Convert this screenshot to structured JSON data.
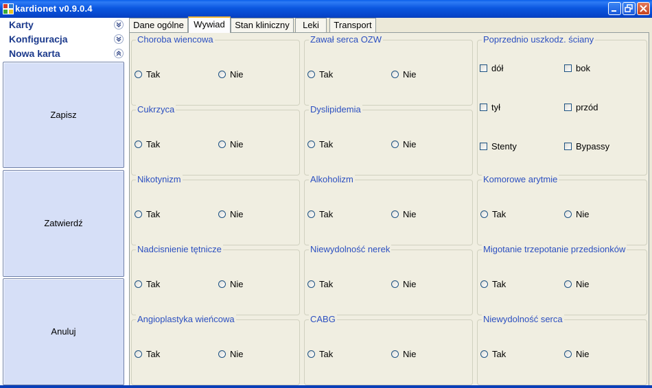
{
  "window": {
    "title": "kardionet v0.9.0.4"
  },
  "sidebar": {
    "nav": [
      {
        "label": "Karty",
        "expanded": false
      },
      {
        "label": "Konfiguracja",
        "expanded": false
      },
      {
        "label": "Nowa karta",
        "expanded": true
      }
    ],
    "buttons": {
      "save": "Zapisz",
      "confirm": "Zatwierdź",
      "cancel": "Anuluj"
    }
  },
  "tabs": [
    {
      "label": "Dane ogólne",
      "active": false
    },
    {
      "label": "Wywiad",
      "active": true
    },
    {
      "label": "Stan kliniczny",
      "active": false
    },
    {
      "label": "Leki",
      "active": false
    },
    {
      "label": "Transport",
      "active": false
    }
  ],
  "radio_groups": [
    {
      "title": "Choroba wiencowa",
      "yes": "Tak",
      "no": "Nie"
    },
    {
      "title": "Zawał serca OZW",
      "yes": "Tak",
      "no": "Nie"
    },
    {
      "title": "Cukrzyca",
      "yes": "Tak",
      "no": "Nie"
    },
    {
      "title": "Dyslipidemia",
      "yes": "Tak",
      "no": "Nie"
    },
    {
      "title": "Nikotynizm",
      "yes": "Tak",
      "no": "Nie"
    },
    {
      "title": "Alkoholizm",
      "yes": "Tak",
      "no": "Nie"
    },
    {
      "title": "Komorowe arytmie",
      "yes": "Tak",
      "no": "Nie"
    },
    {
      "title": "Nadcisnienie tętnicze",
      "yes": "Tak",
      "no": "Nie"
    },
    {
      "title": "Niewydolność nerek",
      "yes": "Tak",
      "no": "Nie"
    },
    {
      "title": "Migotanie trzepotanie przedsionków",
      "yes": "Tak",
      "no": "Nie"
    },
    {
      "title": "Angioplastyka  wieńcowa",
      "yes": "Tak",
      "no": "Nie"
    },
    {
      "title": "CABG",
      "yes": "Tak",
      "no": "Nie"
    },
    {
      "title": "Niewydolność serca",
      "yes": "Tak",
      "no": "Nie"
    }
  ],
  "wall_group": {
    "title": "Poprzednio uszkodz. ściany",
    "options": [
      "dół",
      "bok",
      "tył",
      "przód",
      "Stenty",
      "Bypassy"
    ]
  }
}
